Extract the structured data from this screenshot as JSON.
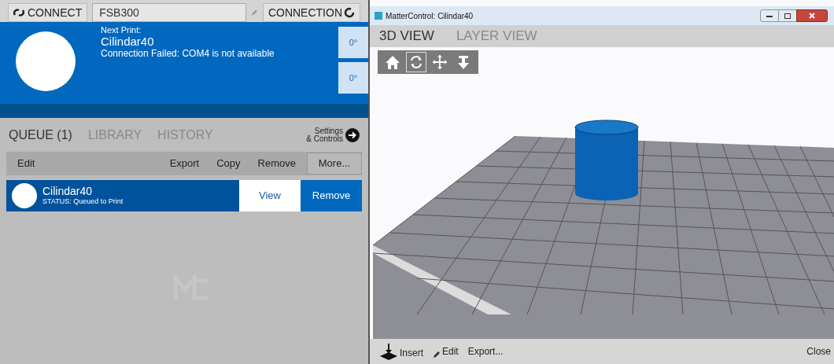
{
  "top_bar": {
    "connect_button": "CONNECT",
    "printer_field": "FSB300",
    "connection_button": "CONNECTION"
  },
  "print_status": {
    "label": "Next Print:",
    "name": "Cilindar40",
    "message": "Connection Failed: COM4 is not available",
    "temperatures": [
      "0°",
      "0°"
    ]
  },
  "tabs": [
    {
      "label": "QUEUE (1)",
      "selected": true
    },
    {
      "label": "LIBRARY",
      "selected": false
    },
    {
      "label": "HISTORY",
      "selected": false
    }
  ],
  "settings_button": {
    "lines": [
      "Settings",
      "& Controls"
    ]
  },
  "queue_toolbar": {
    "edit": "Edit",
    "actions": [
      "Export",
      "Copy",
      "Remove"
    ],
    "more": "More..."
  },
  "queue_items": [
    {
      "name": "Cilindar40",
      "status": "STATUS: Queued to Print",
      "selected": true,
      "actions": [
        {
          "label": "View",
          "kind": "light"
        },
        {
          "label": "Remove",
          "kind": "blue"
        }
      ]
    }
  ],
  "window": {
    "title": "MatterControl: Cilindar40",
    "tabs": [
      {
        "label": "3D VIEW",
        "selected": true
      },
      {
        "label": "LAYER VIEW",
        "selected": false
      }
    ],
    "view_tools": [
      {
        "kind": "home",
        "selected": false
      },
      {
        "kind": "rotate",
        "selected": true
      },
      {
        "kind": "move",
        "selected": false
      },
      {
        "kind": "zoom",
        "selected": false
      }
    ],
    "bottom_bar": {
      "buttons": [
        {
          "label": "Insert",
          "kind": "insert"
        },
        {
          "label": "Edit",
          "kind": "edit"
        },
        {
          "label": "Export...",
          "kind": "plain"
        }
      ],
      "close": "Close"
    }
  }
}
